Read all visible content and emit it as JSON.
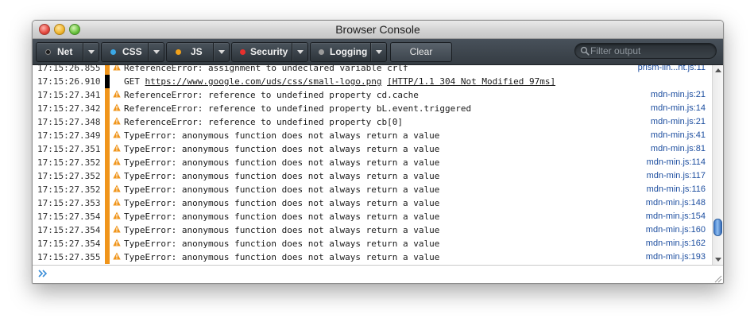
{
  "window": {
    "title": "Browser Console"
  },
  "toolbar": {
    "filters": [
      {
        "label": "Net",
        "dot_color": "#1b1b1b"
      },
      {
        "label": "CSS",
        "dot_color": "#3ba8e6"
      },
      {
        "label": "JS",
        "dot_color": "#f2a21b"
      },
      {
        "label": "Security",
        "dot_color": "#e8302d"
      },
      {
        "label": "Logging",
        "dot_color": "#9a9a9a"
      }
    ],
    "clear_label": "Clear",
    "filter_placeholder": "Filter output"
  },
  "colors": {
    "warning": "#f0951b",
    "network": "#000000",
    "source_link": "#1e4fa0"
  },
  "output": {
    "rows": [
      {
        "time": "17:15:26.855",
        "type": "warning",
        "icon": "warning-icon",
        "message": "ReferenceError: assignment to undeclared variable crlf",
        "source": "prism-lin...ht.js:11"
      },
      {
        "time": "17:15:26.910",
        "type": "network",
        "icon": "",
        "message": "GET ",
        "link": "https://www.google.com/uds/css/small-logo.png",
        "status": "[HTTP/1.1 304 Not Modified 97ms]",
        "source": ""
      },
      {
        "time": "17:15:27.341",
        "type": "warning",
        "icon": "warning-icon",
        "message": "ReferenceError: reference to undefined property cd.cache",
        "source": "mdn-min.js:21"
      },
      {
        "time": "17:15:27.342",
        "type": "warning",
        "icon": "warning-icon",
        "message": "ReferenceError: reference to undefined property bL.event.triggered",
        "source": "mdn-min.js:14"
      },
      {
        "time": "17:15:27.348",
        "type": "warning",
        "icon": "warning-icon",
        "message": "ReferenceError: reference to undefined property cb[0]",
        "source": "mdn-min.js:21"
      },
      {
        "time": "17:15:27.349",
        "type": "warning",
        "icon": "warning-icon",
        "message": "TypeError: anonymous function does not always return a value",
        "source": "mdn-min.js:41"
      },
      {
        "time": "17:15:27.351",
        "type": "warning",
        "icon": "warning-icon",
        "message": "TypeError: anonymous function does not always return a value",
        "source": "mdn-min.js:81"
      },
      {
        "time": "17:15:27.352",
        "type": "warning",
        "icon": "warning-icon",
        "message": "TypeError: anonymous function does not always return a value",
        "source": "mdn-min.js:114"
      },
      {
        "time": "17:15:27.352",
        "type": "warning",
        "icon": "warning-icon",
        "message": "TypeError: anonymous function does not always return a value",
        "source": "mdn-min.js:117"
      },
      {
        "time": "17:15:27.352",
        "type": "warning",
        "icon": "warning-icon",
        "message": "TypeError: anonymous function does not always return a value",
        "source": "mdn-min.js:116"
      },
      {
        "time": "17:15:27.353",
        "type": "warning",
        "icon": "warning-icon",
        "message": "TypeError: anonymous function does not always return a value",
        "source": "mdn-min.js:148"
      },
      {
        "time": "17:15:27.354",
        "type": "warning",
        "icon": "warning-icon",
        "message": "TypeError: anonymous function does not always return a value",
        "source": "mdn-min.js:154"
      },
      {
        "time": "17:15:27.354",
        "type": "warning",
        "icon": "warning-icon",
        "message": "TypeError: anonymous function does not always return a value",
        "source": "mdn-min.js:160"
      },
      {
        "time": "17:15:27.354",
        "type": "warning",
        "icon": "warning-icon",
        "message": "TypeError: anonymous function does not always return a value",
        "source": "mdn-min.js:162"
      },
      {
        "time": "17:15:27.355",
        "type": "warning",
        "icon": "warning-icon",
        "message": "TypeError: anonymous function does not always return a value",
        "source": "mdn-min.js:193"
      }
    ]
  },
  "command_line": {
    "prompt_icon": "chevron-double-right-icon",
    "value": ""
  }
}
